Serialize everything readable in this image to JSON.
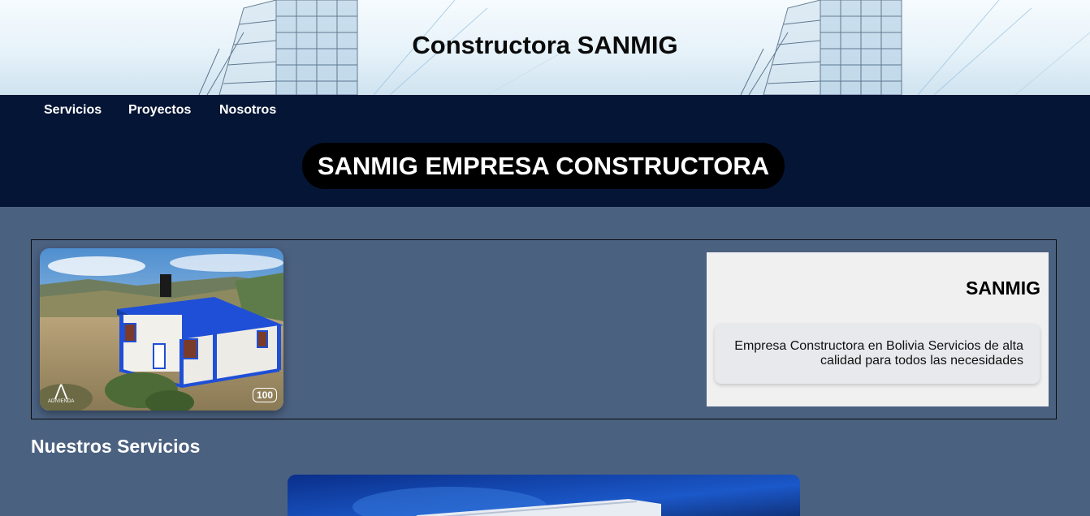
{
  "header": {
    "title": "Constructora SANMIG"
  },
  "nav": {
    "items": [
      {
        "label": "Servicios"
      },
      {
        "label": "Proyectos"
      },
      {
        "label": "Nosotros"
      }
    ]
  },
  "hero": {
    "title": "SANMIG EMPRESA CONSTRUCTORA"
  },
  "feature": {
    "card_title": "SANMIG",
    "card_text": "Empresa Constructora en Bolivia Servicios de alta calidad para todos las necesidades",
    "photo_badge_left": "ADIVIENDA",
    "photo_badge_right": "100"
  },
  "services": {
    "title": "Nuestros Servicios"
  },
  "colors": {
    "page_background": "#4b6180",
    "nav_background": "#051535",
    "hero_pill": "#000000",
    "card_background": "#f0f0f0"
  }
}
